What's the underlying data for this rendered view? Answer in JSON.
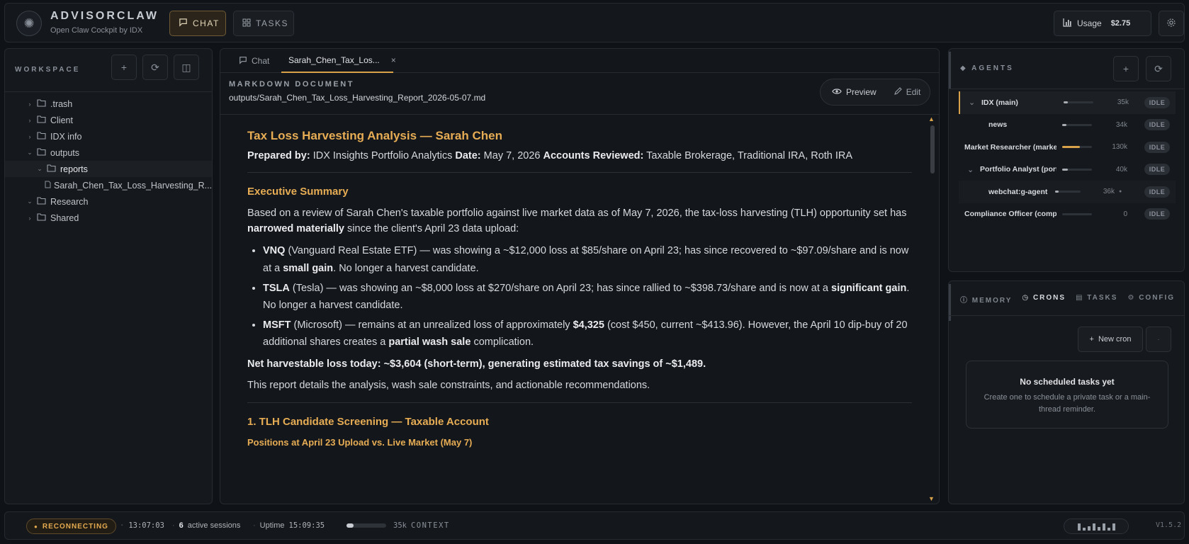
{
  "brand": {
    "name": "ADVISORCLAW",
    "subtitle": "Open Claw Cockpit by IDX"
  },
  "topnav": {
    "chat_label": "CHAT",
    "tasks_label": "TASKS",
    "usage_label": "Usage",
    "usage_amount": "$2.75"
  },
  "workspace": {
    "title": "WORKSPACE",
    "tree": [
      {
        "label": ".trash",
        "depth": 0,
        "type": "folder",
        "expanded": false
      },
      {
        "label": "Client",
        "depth": 0,
        "type": "folder",
        "expanded": false
      },
      {
        "label": "IDX info",
        "depth": 0,
        "type": "folder",
        "expanded": false
      },
      {
        "label": "outputs",
        "depth": 0,
        "type": "folder",
        "expanded": true
      },
      {
        "label": "reports",
        "depth": 1,
        "type": "folder",
        "expanded": true
      },
      {
        "label": "Sarah_Chen_Tax_Loss_Harvesting_R...",
        "depth": 2,
        "type": "file"
      },
      {
        "label": "Research",
        "depth": 0,
        "type": "folder",
        "expanded": true
      },
      {
        "label": "Shared",
        "depth": 0,
        "type": "folder",
        "expanded": false
      }
    ]
  },
  "doc": {
    "tabs": [
      {
        "label": "Chat"
      },
      {
        "label": "Sarah_Chen_Tax_Los..."
      }
    ],
    "kicker": "MARKDOWN DOCUMENT",
    "path": "outputs/Sarah_Chen_Tax_Loss_Harvesting_Report_2026-05-07.md",
    "preview_label": "Preview",
    "edit_label": "Edit",
    "title": "Tax Loss Harvesting Analysis — Sarah Chen",
    "meta": {
      "prepared_k": "Prepared by:",
      "prepared_v": "IDX Insights Portfolio Analytics",
      "date_k": "Date:",
      "date_v": "May 7, 2026",
      "accounts_k": "Accounts Reviewed:",
      "accounts_v": "Taxable Brokerage, Traditional IRA, Roth IRA"
    },
    "exec_title": "Executive Summary",
    "exec_p1a": "Based on a review of Sarah Chen's taxable portfolio against live market data as of May 7, 2026, the tax-loss harvesting (TLH) opportunity set has",
    "exec_p1b": "narrowed materially",
    "exec_p1c": "since the client's April 23 data upload:",
    "b1_t": "VNQ",
    "b1_a": "(Vanguard Real Estate ETF) — was showing a ~$12,000 loss at $85/share on April 23; has since recovered to ~$97.09/share and is now at a",
    "b1_b": "small gain",
    "b1_c": ". No longer a harvest candidate.",
    "b2_t": "TSLA",
    "b2_a": "(Tesla) — was showing an ~$8,000 loss at $270/share on April 23; has since rallied to ~$398.73/share and is now at a",
    "b2_b": "significant gain",
    "b2_c": ". No longer a harvest candidate.",
    "b3_t": "MSFT",
    "b3_a": "(Microsoft) — remains at an unrealized loss of approximately",
    "b3_b": "$4,325",
    "b3_c": "(cost $450, current ~$413.96). However, the April 10 dip-buy of 20 additional shares creates a",
    "b3_d": "partial wash sale",
    "b3_e": "complication.",
    "net": "Net harvestable loss today: ~$3,604 (short-term), generating estimated tax savings of ~$1,489.",
    "report_p": "This report details the analysis, wash sale constraints, and actionable recommendations.",
    "s1_title": "1. TLH Candidate Screening — Taxable Account",
    "s1_sub": "Positions at April 23 Upload vs. Live Market (May 7)"
  },
  "agents": {
    "title": "AGENTS",
    "rows": [
      {
        "name": "IDX (main)",
        "tokens": "35k",
        "status": "IDLE",
        "level": 0.15,
        "indent": 1,
        "chevron": true
      },
      {
        "name": "news",
        "tokens": "34k",
        "status": "IDLE",
        "level": 0.15,
        "indent": 2,
        "chevron": false
      },
      {
        "name": "Market Researcher (market",
        "tokens": "130k",
        "status": "IDLE",
        "level": 0.6,
        "indent": 0,
        "chevron": false
      },
      {
        "name": "Portfolio Analyst (port",
        "tokens": "40k",
        "status": "IDLE",
        "level": 0.18,
        "indent": 1,
        "chevron": true
      },
      {
        "name": "webchat:g-agent",
        "tokens": "36k",
        "status": "IDLE",
        "level": 0.15,
        "indent": 2,
        "chevron": false
      },
      {
        "name": "Compliance Officer (compli",
        "tokens": "0",
        "status": "IDLE",
        "level": 0,
        "indent": 0,
        "chevron": false
      }
    ]
  },
  "crons": {
    "tabs": [
      "MEMORY",
      "CRONS",
      "TASKS",
      "CONFIG"
    ],
    "new_label": "New cron",
    "empty_title": "No scheduled tasks yet",
    "empty_sub": "Create one to schedule a private task or a main-thread reminder."
  },
  "status": {
    "conn": "RECONNECTING",
    "time": "13:07:03",
    "sessions_count": "6",
    "sessions_label": "active sessions",
    "uptime_label": "Uptime",
    "uptime": "15:09:35",
    "context_level": 0.17,
    "context_tokens": "35k",
    "context_label": "CONTEXT",
    "version": "V1.5.2"
  },
  "colors": {
    "accent": "#d8a24a",
    "background": "#0f1216",
    "panel": "#15181d"
  }
}
